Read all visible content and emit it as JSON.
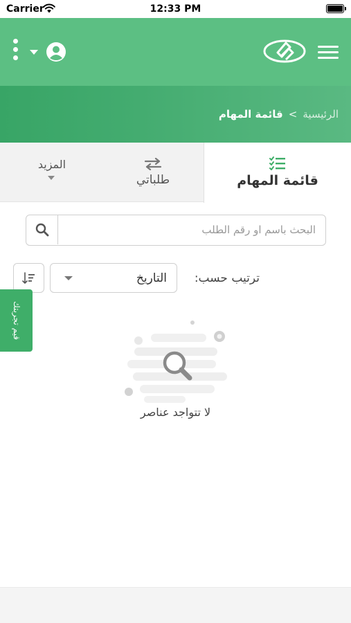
{
  "status_bar": {
    "carrier": "Carrier",
    "time": "12:33 PM"
  },
  "header": {
    "menu_icon": "hamburger-icon",
    "logo_icon": "app-logo",
    "kebab_icon": "more-vertical-icon",
    "user_icon": "user-circle-icon",
    "background_color": "#5cbf83"
  },
  "breadcrumb": {
    "home": "الرئيسية",
    "separator": ">",
    "current": "قائمة المهام"
  },
  "tabs": {
    "tasks": {
      "label": "قائمة المهام",
      "icon": "task-list-icon",
      "active": true
    },
    "requests": {
      "label": "طلباتي",
      "icon": "swap-arrows-icon"
    },
    "more": {
      "label": "المزيد",
      "icon": "caret-down-icon"
    }
  },
  "search": {
    "placeholder": "البحث باسم او رقم الطلب",
    "value": "",
    "icon": "search-icon"
  },
  "sort": {
    "label": "ترتيب حسب:",
    "selected": "التاريخ",
    "order_icon": "sort-order-icon"
  },
  "feedback": {
    "label": "قيم تجربتك",
    "color": "#3fae69"
  },
  "empty_state": {
    "message": "لا تتواجد عناصر",
    "icon": "magnifier-icon"
  }
}
